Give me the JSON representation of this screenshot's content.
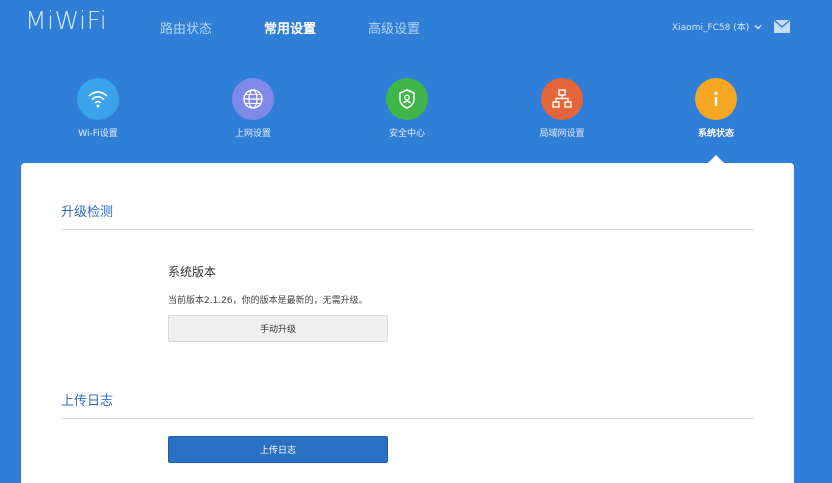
{
  "header": {
    "logo": "MiWiFi",
    "nav": [
      {
        "label": "路由状态",
        "active": false
      },
      {
        "label": "常用设置",
        "active": true
      },
      {
        "label": "高级设置",
        "active": false
      }
    ],
    "router_name": "Xiaomi_FC58 (本)",
    "chevron_icon": "chevron-down-icon",
    "mail_icon": "mail-icon"
  },
  "settings_icons": [
    {
      "label": "Wi-Fi设置",
      "icon": "wifi-icon",
      "color": "#3aa3ec",
      "active": false
    },
    {
      "label": "上网设置",
      "icon": "globe-icon",
      "color": "#7f8ae8",
      "active": false
    },
    {
      "label": "安全中心",
      "icon": "shield-icon",
      "color": "#3fb54a",
      "active": false
    },
    {
      "label": "局域网设置",
      "icon": "network-icon",
      "color": "#e5663a",
      "active": false
    },
    {
      "label": "系统状态",
      "icon": "info-icon",
      "color": "#f5a623",
      "active": true
    }
  ],
  "upgrade": {
    "title": "升级检测",
    "subtitle": "系统版本",
    "version_text": "当前版本2.1.26，你的版本是最新的，无需升级。",
    "manual_button": "手动升级"
  },
  "log": {
    "title": "上传日志",
    "upload_button": "上传日志"
  },
  "colors": {
    "background": "#2f7fd8",
    "accent": "#2a70c5",
    "section_title": "#2f6bb8"
  }
}
